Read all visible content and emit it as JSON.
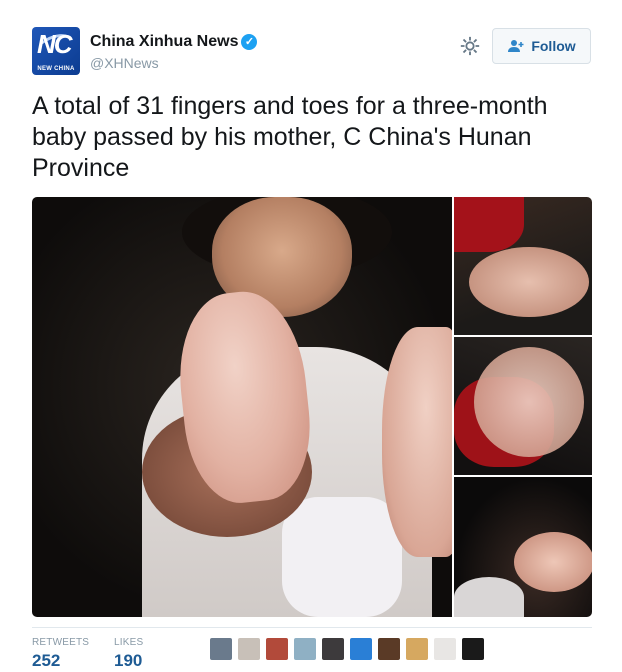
{
  "account": {
    "avatar_text": "NC",
    "avatar_subtext": "NEW CHINA",
    "display_name": "China Xinhua News",
    "verified_icon": "verified-badge-icon",
    "handle": "@XHNews"
  },
  "actions": {
    "settings_icon": "gear-icon",
    "follow_label": "Follow",
    "follow_icon": "add-user-icon"
  },
  "tweet": {
    "text": "A total of 31 fingers and toes for a three-month baby passed by his mother, C China's Hunan Province"
  },
  "media": {
    "count": 4
  },
  "stats": {
    "retweets_label": "RETWEETS",
    "retweets_value": "252",
    "likes_label": "LIKES",
    "likes_value": "190",
    "likers_colors": [
      "#6a7a8c",
      "#c8c0b8",
      "#b24a3a",
      "#8fb0c4",
      "#3d3a3c",
      "#2a7fd6",
      "#5a3a26",
      "#d6a860",
      "#e8e6e4",
      "#1a1a1a"
    ]
  },
  "colors": {
    "accent": "#1da1f2",
    "link": "#1e5b94",
    "muted": "#8899a6"
  }
}
